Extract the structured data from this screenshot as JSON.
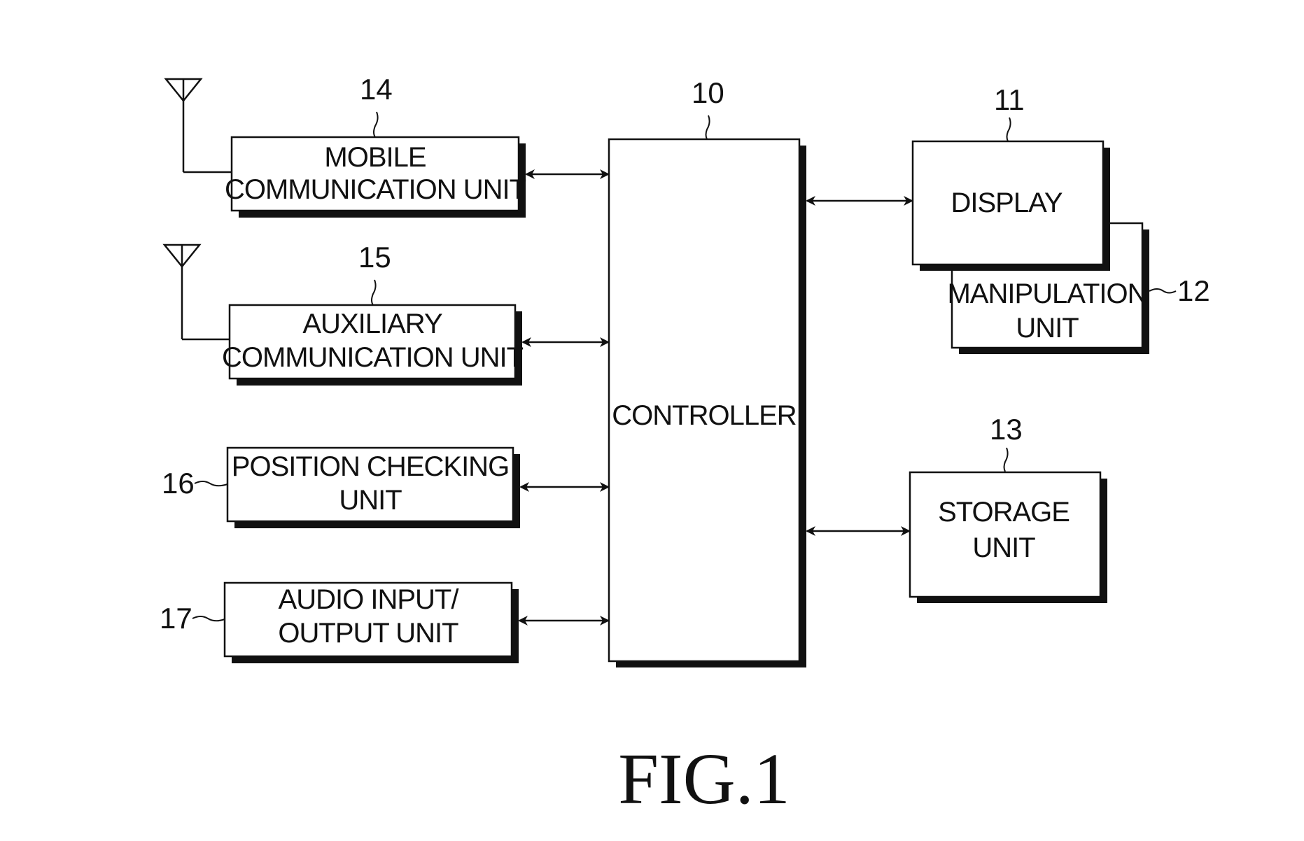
{
  "figure_title": "FIG.1",
  "blocks": {
    "controller": {
      "ref": "10",
      "lines": [
        "CONTROLLER"
      ]
    },
    "display": {
      "ref": "11",
      "lines": [
        "DISPLAY"
      ]
    },
    "manipulation": {
      "ref": "12",
      "lines": [
        "MANIPULATION",
        "UNIT"
      ]
    },
    "storage": {
      "ref": "13",
      "lines": [
        "STORAGE",
        "UNIT"
      ]
    },
    "mobile_comm": {
      "ref": "14",
      "lines": [
        "MOBILE",
        "COMMUNICATION UNIT"
      ]
    },
    "aux_comm": {
      "ref": "15",
      "lines": [
        "AUXILIARY",
        "COMMUNICATION UNIT"
      ]
    },
    "position": {
      "ref": "16",
      "lines": [
        "POSITION CHECKING",
        "UNIT"
      ]
    },
    "audio": {
      "ref": "17",
      "lines": [
        "AUDIO INPUT/",
        "OUTPUT UNIT"
      ]
    }
  },
  "icons": {
    "antenna": "antenna-icon"
  },
  "connections": [
    {
      "from": "mobile_comm",
      "to": "controller",
      "type": "bidirectional"
    },
    {
      "from": "aux_comm",
      "to": "controller",
      "type": "bidirectional"
    },
    {
      "from": "position",
      "to": "controller",
      "type": "bidirectional"
    },
    {
      "from": "audio",
      "to": "controller",
      "type": "bidirectional"
    },
    {
      "from": "controller",
      "to": "display",
      "type": "bidirectional"
    },
    {
      "from": "controller",
      "to": "storage",
      "type": "bidirectional"
    }
  ],
  "colors": {
    "ink": "#111111",
    "paper": "#ffffff"
  }
}
